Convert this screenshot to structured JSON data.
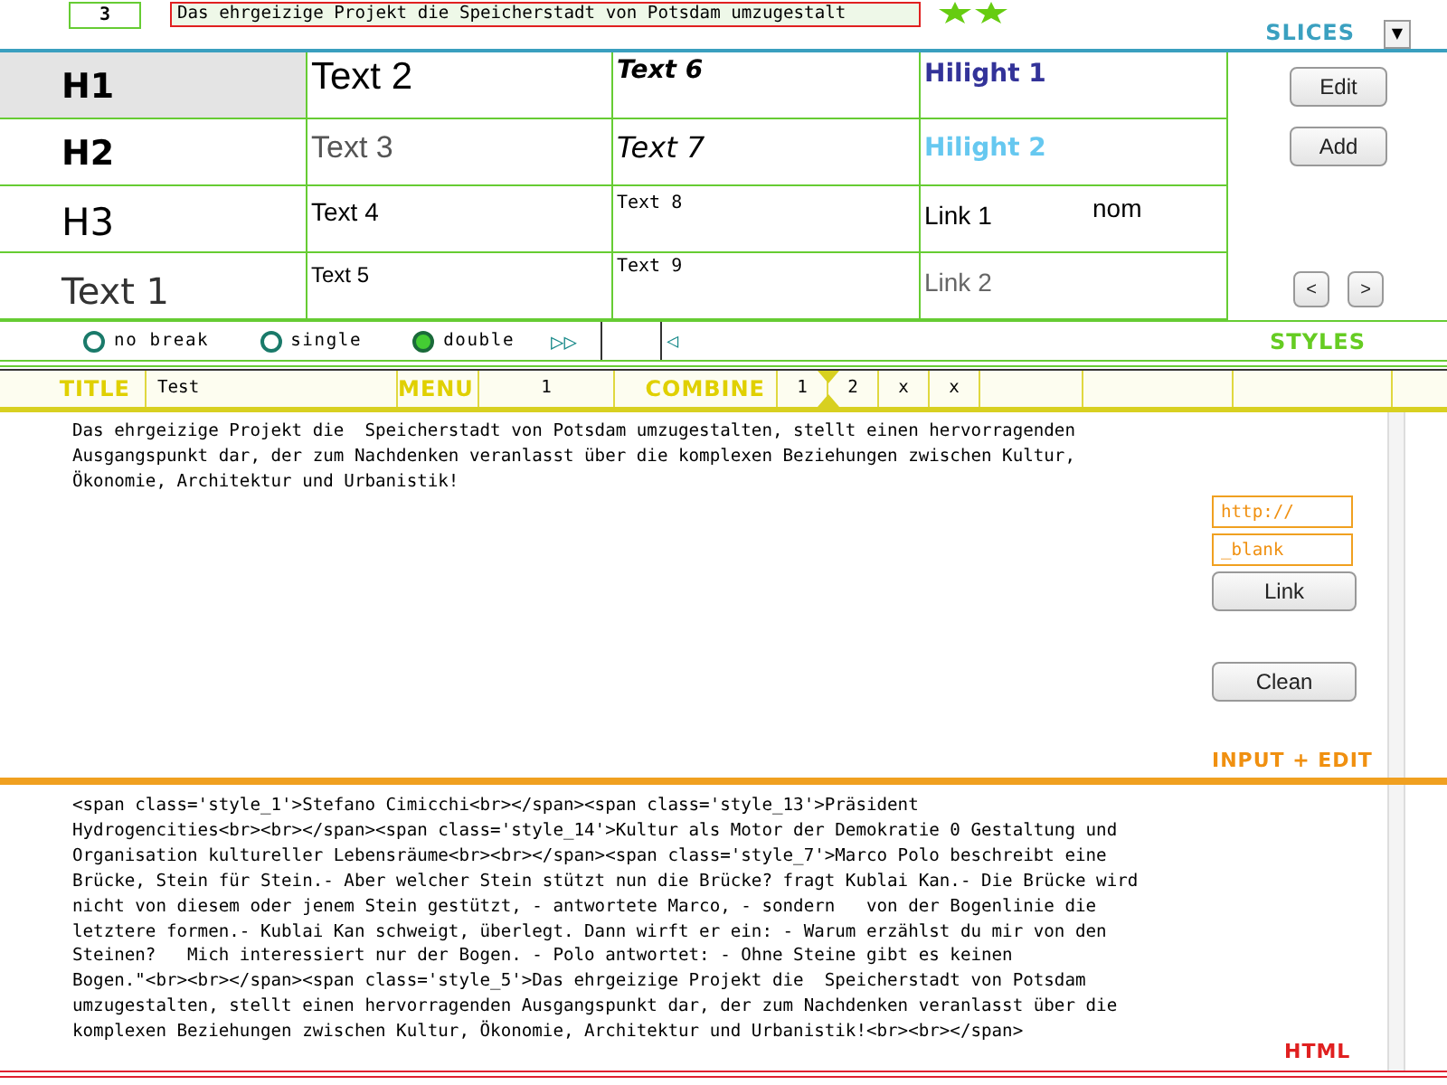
{
  "slices": {
    "number": "3",
    "text": "Das ehrgeizige Projekt die  Speicherstadt von Potsdam umzugestalt",
    "label": "SLICES",
    "dropdown": "▼"
  },
  "styles": {
    "rows": [
      [
        {
          "text": "H1",
          "kind": "h1",
          "selected": true
        },
        {
          "text": "Text 2",
          "kind": "text2",
          "selected": false
        },
        {
          "text": "Text 6",
          "kind": "text6",
          "selected": false
        },
        {
          "text": "Hilight 1",
          "kind": "hilight1",
          "selected": false
        }
      ],
      [
        {
          "text": "H2",
          "kind": "h2",
          "selected": false
        },
        {
          "text": "Text 3",
          "kind": "text3",
          "selected": false
        },
        {
          "text": "Text 7",
          "kind": "text7",
          "selected": false
        },
        {
          "text": "Hilight 2",
          "kind": "hilight2",
          "selected": false
        }
      ],
      [
        {
          "text": "H3",
          "kind": "h3",
          "selected": false
        },
        {
          "text": "Text 4",
          "kind": "text4",
          "selected": false
        },
        {
          "text": "Text 8",
          "kind": "text8",
          "selected": false
        },
        {
          "text": "Link 1",
          "kind": "link1",
          "selected": false,
          "trailing": "nom"
        }
      ],
      [
        {
          "text": "Text 1",
          "kind": "text1",
          "selected": false
        },
        {
          "text": "Text 5",
          "kind": "text5",
          "selected": false
        },
        {
          "text": "Text 9",
          "kind": "text9",
          "selected": false
        },
        {
          "text": "Link 2",
          "kind": "link2",
          "selected": false
        }
      ]
    ],
    "buttons": [
      "Edit",
      "Add"
    ],
    "nav": [
      "<",
      ">"
    ],
    "options": [
      {
        "label": "no break",
        "selected": false
      },
      {
        "label": "single",
        "selected": false
      },
      {
        "label": "double",
        "selected": true
      }
    ],
    "forward": "▷▷",
    "back": "◁",
    "label": "STYLES"
  },
  "title_bar": {
    "title_label": "TITLE",
    "title": "Test",
    "menu_label": "MENU",
    "menu": "1",
    "combine_label": "COMBINE",
    "combine": [
      "1",
      "2",
      "x",
      "x"
    ]
  },
  "edit": {
    "lines": [
      "Das ehrgeizige Projekt die  Speicherstadt von Potsdam umzugestalten, stellt einen hervorragenden",
      "Ausgangspunkt dar, der zum Nachdenken veranlasst über die komplexen Beziehungen zwischen Kultur,",
      "Ökonomie, Architektur und Urbanistik!"
    ],
    "url": "http://",
    "target": "_blank",
    "link_button": "Link",
    "clean_button": "Clean",
    "label": "INPUT + EDIT"
  },
  "html": {
    "lines": [
      "<span class='style_1'>Stefano Cimicchi<br></span><span class='style_13'>Präsident",
      "Hydrogencities<br><br></span><span class='style_14'>Kultur als Motor der Demokratie 0 Gestaltung und",
      "Organisation kultureller Lebensräume<br><br></span><span class='style_7'>Marco Polo beschreibt eine",
      "Brücke, Stein für Stein.- Aber welcher Stein stützt nun die Brücke? fragt Kublai Kan.- Die Brücke wird",
      "nicht von diesem oder jenem Stein gestützt, - antwortete Marco, - sondern   von der Bogenlinie die",
      "letztere formen.- Kublai Kan schweigt, überlegt. Dann wirft er ein: - Warum erzählst du mir von den",
      "Steinen?   Mich interessiert nur der Bogen. - Polo antwortet: - Ohne Steine gibt es keinen",
      "Bogen.\"<br><br></span><span class='style_5'>Das ehrgeizige Projekt die  Speicherstadt von Potsdam",
      "umzugestalten, stellt einen hervorragenden Ausgangspunkt dar, der zum Nachdenken veranlasst über die",
      "komplexen Beziehungen zwischen Kultur, Ökonomie, Architektur und Urbanistik!<br><br></span>"
    ],
    "label": "HTML"
  }
}
